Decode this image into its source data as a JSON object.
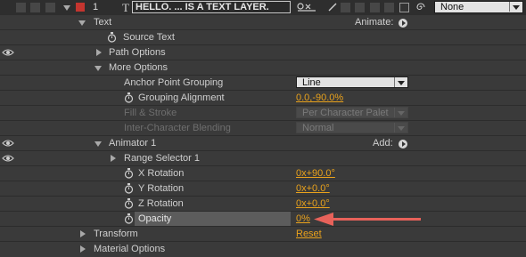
{
  "layer": {
    "number": "1",
    "type_icon": "T",
    "name": "HELLO. ... IS A TEXT LAYER.",
    "parent_value": "None",
    "label_color": "#c4352f"
  },
  "text_group": {
    "label": "Text",
    "animate_label": "Animate:",
    "source_text_label": "Source Text",
    "path_options_label": "Path Options",
    "more_options_label": "More Options",
    "anchor_grouping_label": "Anchor Point Grouping",
    "anchor_grouping_value": "Line",
    "grouping_alignment_label": "Grouping Alignment",
    "grouping_alignment_value": "0.0,-90.0%",
    "fill_stroke_label": "Fill & Stroke",
    "fill_stroke_value": "Per Character Palet",
    "inter_char_label": "Inter-Character Blending",
    "inter_char_value": "Normal"
  },
  "animator": {
    "label": "Animator 1",
    "add_label": "Add:",
    "range_selector_label": "Range Selector 1",
    "x_rotation_label": "X Rotation",
    "x_rotation_value": "0x+90.0°",
    "y_rotation_label": "Y Rotation",
    "y_rotation_value": "0x+0.0°",
    "z_rotation_label": "Z Rotation",
    "z_rotation_value": "0x+0.0°",
    "opacity_label": "Opacity",
    "opacity_value": "0%"
  },
  "transform": {
    "label": "Transform",
    "reset_label": "Reset"
  },
  "material_options": {
    "label": "Material Options"
  },
  "colors": {
    "accent_value": "#e9a21c",
    "annotation_arrow": "#e8625a"
  }
}
